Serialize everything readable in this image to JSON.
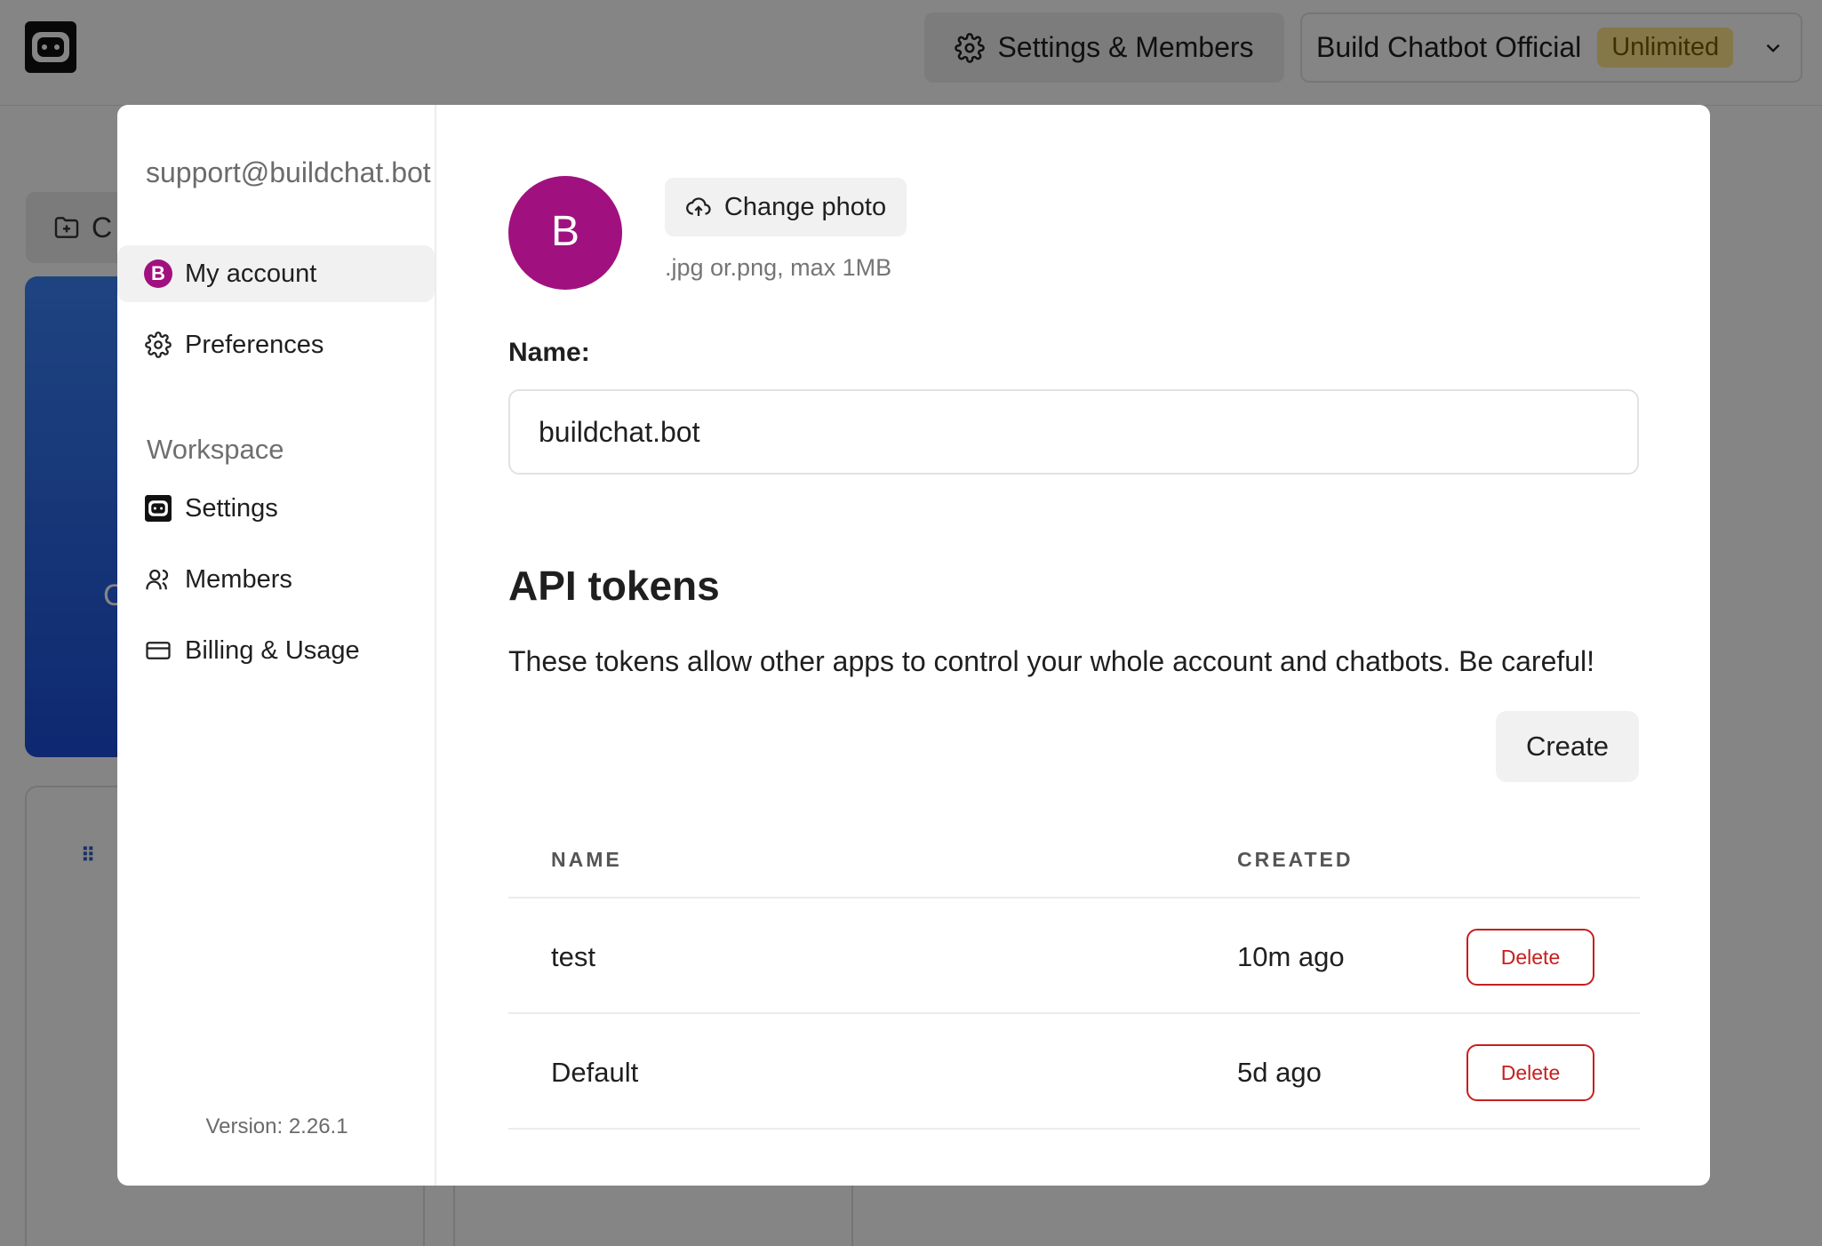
{
  "header": {
    "settings_button_label": "Settings & Members",
    "workspace_name": "Build Chatbot Official",
    "workspace_plan": "Unlimited"
  },
  "background": {
    "folder_button_label": "C",
    "card_text": "C"
  },
  "sidebar": {
    "email": "support@buildchat.bot",
    "account_items": [
      {
        "label": "My account",
        "icon": "avatar-icon",
        "avatar_letter": "B",
        "active": true
      },
      {
        "label": "Preferences",
        "icon": "gear-icon"
      }
    ],
    "workspace_heading": "Workspace",
    "workspace_items": [
      {
        "label": "Settings",
        "icon": "bot-logo-icon"
      },
      {
        "label": "Members",
        "icon": "users-icon"
      },
      {
        "label": "Billing & Usage",
        "icon": "credit-card-icon"
      }
    ],
    "version": "Version: 2.26.1"
  },
  "account": {
    "avatar_letter": "B",
    "avatar_color": "#a0117f",
    "change_photo_label": "Change photo",
    "photo_hint": ".jpg or.png, max 1MB",
    "name_label": "Name:",
    "name_value": "buildchat.bot"
  },
  "api_tokens": {
    "title": "API tokens",
    "description": "These tokens allow other apps to control your whole account and chatbots. Be careful!",
    "create_label": "Create",
    "columns": [
      "NAME",
      "CREATED"
    ],
    "rows": [
      {
        "name": "test",
        "created": "10m ago",
        "action": "Delete"
      },
      {
        "name": "Default",
        "created": "5d ago",
        "action": "Delete"
      }
    ]
  },
  "colors": {
    "accent_avatar": "#a0117f",
    "danger": "#c81e1e",
    "badge_bg": "#fde68a"
  }
}
